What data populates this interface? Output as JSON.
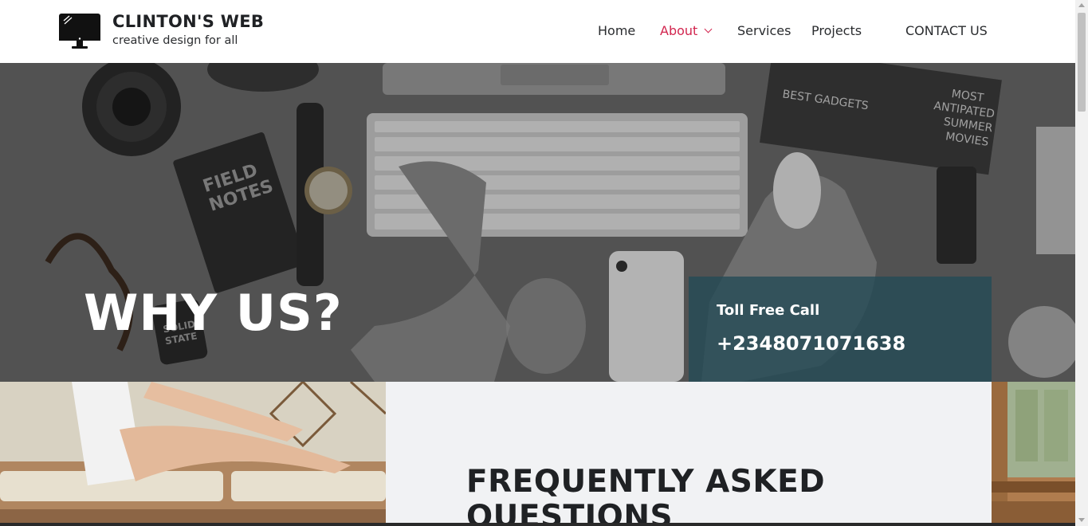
{
  "header": {
    "brand_title": "CLINTON'S WEB",
    "brand_tagline": "creative design for all",
    "logo_icon": "desktop-monitor-icon"
  },
  "nav": {
    "items": [
      {
        "label": "Home"
      },
      {
        "label": "About",
        "active": true,
        "has_dropdown": true
      },
      {
        "label": "Services"
      },
      {
        "label": "Projects"
      },
      {
        "label": "CONTACT US"
      }
    ],
    "active_color": "#d2264f"
  },
  "hero": {
    "title": "WHY US?",
    "call_label": "Toll Free Call",
    "call_number": "+2348071071638",
    "overlay_color": "#224a56"
  },
  "faq": {
    "title": "FREQUENTLY ASKED QUESTIONS"
  }
}
